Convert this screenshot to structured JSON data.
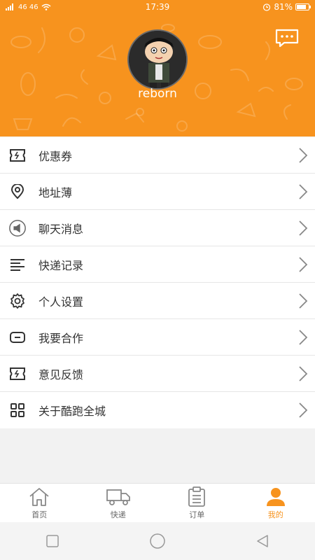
{
  "status_bar": {
    "signal_text": "46 46",
    "time": "17:39",
    "battery": "81%",
    "battery_level": 0.81
  },
  "profile": {
    "username": "reborn"
  },
  "menu": [
    {
      "label": "优惠券",
      "icon": "coupon-icon"
    },
    {
      "label": "地址薄",
      "icon": "location-pin-icon"
    },
    {
      "label": "聊天消息",
      "icon": "megaphone-icon"
    },
    {
      "label": "快递记录",
      "icon": "list-icon"
    },
    {
      "label": "个人设置",
      "icon": "gear-icon"
    },
    {
      "label": "我要合作",
      "icon": "cooperate-icon"
    },
    {
      "label": "意见反馈",
      "icon": "feedback-ticket-icon"
    },
    {
      "label": "关于酷跑全城",
      "icon": "grid-icon"
    }
  ],
  "tabs": [
    {
      "label": "首页",
      "icon": "home-icon",
      "active": false
    },
    {
      "label": "快递",
      "icon": "truck-icon",
      "active": false
    },
    {
      "label": "订单",
      "icon": "clipboard-icon",
      "active": false
    },
    {
      "label": "我的",
      "icon": "person-icon",
      "active": true
    }
  ],
  "colors": {
    "brand": "#f7931e",
    "background": "#f2f2f2"
  }
}
